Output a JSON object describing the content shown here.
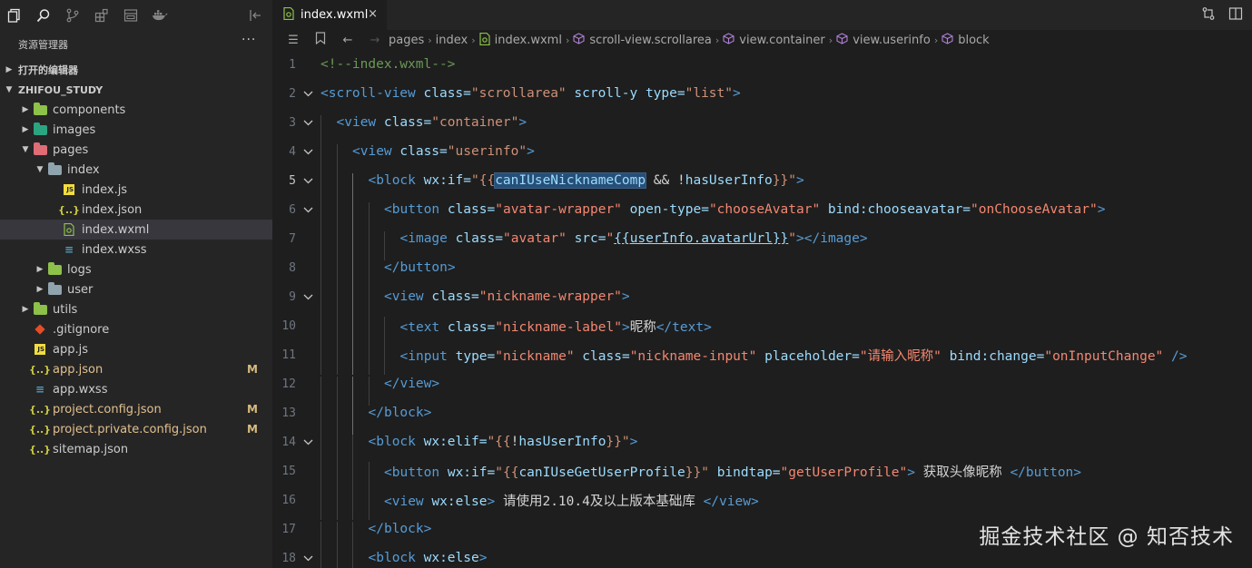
{
  "activity": {
    "icons": [
      "files-icon",
      "search-icon",
      "source-control-icon",
      "extensions-icon",
      "remote-icon",
      "docker-icon"
    ],
    "collapse_icon": "collapse-sidebar-icon"
  },
  "explorer": {
    "title": "资源管理器",
    "more": "···",
    "open_editors": "打开的编辑器",
    "project": "ZHIFOU_STUDY"
  },
  "tree": [
    {
      "label": "components",
      "type": "folder",
      "depth": 1,
      "expanded": false,
      "color": "#8dc149"
    },
    {
      "label": "images",
      "type": "folder",
      "depth": 1,
      "expanded": false,
      "color": "#2ba580"
    },
    {
      "label": "pages",
      "type": "folder",
      "depth": 1,
      "expanded": true,
      "color": "#e06c75"
    },
    {
      "label": "index",
      "type": "folder",
      "depth": 2,
      "expanded": true,
      "color": "#90a4ae"
    },
    {
      "label": "index.js",
      "type": "js",
      "depth": 3
    },
    {
      "label": "index.json",
      "type": "json",
      "depth": 3
    },
    {
      "label": "index.wxml",
      "type": "wxml",
      "depth": 3,
      "selected": true
    },
    {
      "label": "index.wxss",
      "type": "css",
      "depth": 3
    },
    {
      "label": "logs",
      "type": "folder",
      "depth": 2,
      "expanded": false,
      "color": "#8dc149"
    },
    {
      "label": "user",
      "type": "folder",
      "depth": 2,
      "expanded": false,
      "color": "#90a4ae"
    },
    {
      "label": "utils",
      "type": "folder",
      "depth": 1,
      "expanded": false,
      "color": "#8dc149"
    },
    {
      "label": ".gitignore",
      "type": "git",
      "depth": 1
    },
    {
      "label": "app.js",
      "type": "js",
      "depth": 1
    },
    {
      "label": "app.json",
      "type": "json",
      "depth": 1,
      "badge": "M"
    },
    {
      "label": "app.wxss",
      "type": "css",
      "depth": 1
    },
    {
      "label": "project.config.json",
      "type": "json",
      "depth": 1,
      "badge": "M"
    },
    {
      "label": "project.private.config.json",
      "type": "json",
      "depth": 1,
      "badge": "M"
    },
    {
      "label": "sitemap.json",
      "type": "json",
      "depth": 1
    }
  ],
  "tab": {
    "label": "index.wxml",
    "close": "×",
    "actions": [
      "compare-changes-icon",
      "split-editor-icon"
    ]
  },
  "breadcrumb": {
    "items": [
      "pages",
      "index",
      "index.wxml",
      "scroll-view.scrollarea",
      "view.container",
      "view.userinfo",
      "block"
    ]
  },
  "code_lines": [
    {
      "n": "1",
      "indent": 0,
      "fold": "",
      "tokens": [
        [
          "cmt",
          "<!--index.wxml-->"
        ]
      ]
    },
    {
      "n": "2",
      "indent": 0,
      "fold": "v",
      "tokens": [
        [
          "tag",
          "<scroll-view "
        ],
        [
          "attr",
          "class="
        ],
        [
          "str-o",
          "\"scrollarea\""
        ],
        [
          "attr",
          " scroll-y type="
        ],
        [
          "str-o",
          "\"list\""
        ],
        [
          "tag",
          ">"
        ]
      ]
    },
    {
      "n": "3",
      "indent": 1,
      "fold": "v",
      "tokens": [
        [
          "tag",
          "<view "
        ],
        [
          "attr",
          "class="
        ],
        [
          "str-o",
          "\"container\""
        ],
        [
          "tag",
          ">"
        ]
      ]
    },
    {
      "n": "4",
      "indent": 2,
      "fold": "v",
      "tokens": [
        [
          "tag",
          "<view "
        ],
        [
          "attr",
          "class="
        ],
        [
          "str-o",
          "\"userinfo\""
        ],
        [
          "tag",
          ">"
        ]
      ]
    },
    {
      "n": "5",
      "indent": 3,
      "fold": "v",
      "cur": true,
      "tokens": [
        [
          "tag",
          "<block "
        ],
        [
          "attr",
          "wx:if="
        ],
        [
          "str-o",
          "\"{{"
        ],
        [
          "attr hl",
          "canIUseNicknameComp"
        ],
        [
          "txt",
          " && "
        ],
        [
          "txt",
          "!"
        ],
        [
          "attr",
          "hasUserInfo"
        ],
        [
          "str-o",
          "}}\""
        ],
        [
          "tag",
          ">"
        ]
      ]
    },
    {
      "n": "6",
      "indent": 4,
      "fold": "v",
      "tokens": [
        [
          "tag",
          "<button "
        ],
        [
          "attr",
          "class="
        ],
        [
          "str",
          "\"avatar-wrapper\""
        ],
        [
          "attr",
          " open-type="
        ],
        [
          "str",
          "\"chooseAvatar\""
        ],
        [
          "attr",
          " bind:chooseavatar="
        ],
        [
          "str",
          "\"onChooseAvatar\""
        ],
        [
          "tag",
          ">"
        ]
      ]
    },
    {
      "n": "7",
      "indent": 5,
      "fold": "",
      "tokens": [
        [
          "tag",
          "<image "
        ],
        [
          "attr",
          "class="
        ],
        [
          "str",
          "\"avatar\""
        ],
        [
          "attr",
          " src="
        ],
        [
          "str",
          "\""
        ],
        [
          "attr ul",
          "{{userInfo.avatarUrl}}"
        ],
        [
          "str",
          "\""
        ],
        [
          "tag",
          "></image>"
        ]
      ]
    },
    {
      "n": "8",
      "indent": 4,
      "fold": "",
      "tokens": [
        [
          "tag",
          "</button>"
        ]
      ]
    },
    {
      "n": "9",
      "indent": 4,
      "fold": "v",
      "tokens": [
        [
          "tag",
          "<view "
        ],
        [
          "attr",
          "class="
        ],
        [
          "str",
          "\"nickname-wrapper\""
        ],
        [
          "tag",
          ">"
        ]
      ]
    },
    {
      "n": "10",
      "indent": 5,
      "fold": "",
      "tokens": [
        [
          "tag",
          "<text "
        ],
        [
          "attr",
          "class="
        ],
        [
          "str",
          "\"nickname-label\""
        ],
        [
          "tag",
          ">"
        ],
        [
          "txt",
          "昵称"
        ],
        [
          "tag",
          "</text>"
        ]
      ]
    },
    {
      "n": "11",
      "indent": 5,
      "fold": "",
      "tokens": [
        [
          "tag",
          "<input "
        ],
        [
          "attr",
          "type="
        ],
        [
          "str",
          "\"nickname\""
        ],
        [
          "attr",
          " class="
        ],
        [
          "str",
          "\"nickname-input\""
        ],
        [
          "attr",
          " placeholder="
        ],
        [
          "str",
          "\"请输入昵称\""
        ],
        [
          "attr",
          " bind:change="
        ],
        [
          "str",
          "\"onInputChange\""
        ],
        [
          "tag",
          " />"
        ]
      ]
    },
    {
      "n": "12",
      "indent": 4,
      "fold": "",
      "tokens": [
        [
          "tag",
          "</view>"
        ]
      ]
    },
    {
      "n": "13",
      "indent": 3,
      "fold": "",
      "tokens": [
        [
          "tag",
          "</block>"
        ]
      ]
    },
    {
      "n": "14",
      "indent": 3,
      "fold": "v",
      "tokens": [
        [
          "tag",
          "<block "
        ],
        [
          "attr",
          "wx:elif="
        ],
        [
          "str-o",
          "\"{{"
        ],
        [
          "txt",
          "!"
        ],
        [
          "attr",
          "hasUserInfo"
        ],
        [
          "str-o",
          "}}\""
        ],
        [
          "tag",
          ">"
        ]
      ]
    },
    {
      "n": "15",
      "indent": 4,
      "fold": "",
      "tokens": [
        [
          "tag",
          "<button "
        ],
        [
          "attr",
          "wx:if="
        ],
        [
          "str-o",
          "\"{{"
        ],
        [
          "attr",
          "canIUseGetUserProfile"
        ],
        [
          "str-o",
          "}}\""
        ],
        [
          "attr",
          " bindtap="
        ],
        [
          "str",
          "\"getUserProfile\""
        ],
        [
          "tag",
          ">"
        ],
        [
          "txt",
          " 获取头像昵称 "
        ],
        [
          "tag",
          "</button>"
        ]
      ]
    },
    {
      "n": "16",
      "indent": 4,
      "fold": "",
      "tokens": [
        [
          "tag",
          "<view "
        ],
        [
          "attr",
          "wx:else"
        ],
        [
          "tag",
          ">"
        ],
        [
          "txt",
          " 请使用2.10.4及以上版本基础库 "
        ],
        [
          "tag",
          "</view>"
        ]
      ]
    },
    {
      "n": "17",
      "indent": 3,
      "fold": "",
      "tokens": [
        [
          "tag",
          "</block>"
        ]
      ]
    },
    {
      "n": "18",
      "indent": 3,
      "fold": "v",
      "tokens": [
        [
          "tag",
          "<block "
        ],
        [
          "attr",
          "wx:else"
        ],
        [
          "tag",
          ">"
        ]
      ]
    }
  ],
  "watermark": "掘金技术社区 @ 知否技术"
}
